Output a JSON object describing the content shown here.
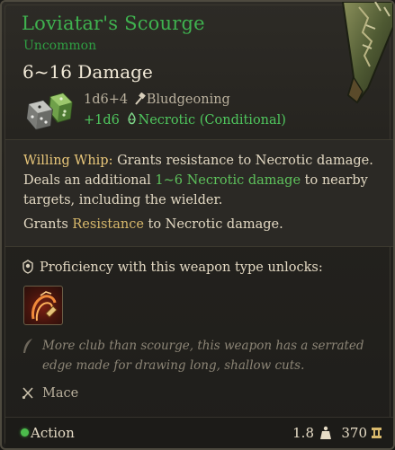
{
  "item": {
    "name": "Loviatar's Scourge",
    "rarity": "Uncommon",
    "damage_total": "6~16 Damage",
    "damage_lines": [
      {
        "dice": "1d6+4",
        "type": "Bludgeoning",
        "icon": "bludgeoning-icon"
      },
      {
        "dice": "+1d6",
        "type": "Necrotic (Conditional)",
        "icon": "necrotic-icon"
      }
    ]
  },
  "passive": {
    "name": "Willing Whip:",
    "text_1": " Grants resistance to Necrotic damage. Deals an additional ",
    "highlight": "1~6 Necrotic damage",
    "text_2": " to nearby targets, including the wielder."
  },
  "grants": {
    "prefix": "Grants ",
    "keyword": "Resistance",
    "suffix": " to Necrotic damage."
  },
  "proficiency": {
    "label": "Proficiency with this weapon type unlocks:",
    "action_icon": "weapon-action-icon"
  },
  "flavor": "More club than scourge, this weapon has a serrated edge made for drawing long, shallow cuts.",
  "weapon_type": "Mace",
  "footer": {
    "action": "Action",
    "weight": "1.8",
    "price": "370"
  },
  "colors": {
    "uncommon": "#3fb24f",
    "necrotic": "#4fc55d",
    "passive_name": "#e9c77a",
    "gold": "#d9b96c"
  }
}
